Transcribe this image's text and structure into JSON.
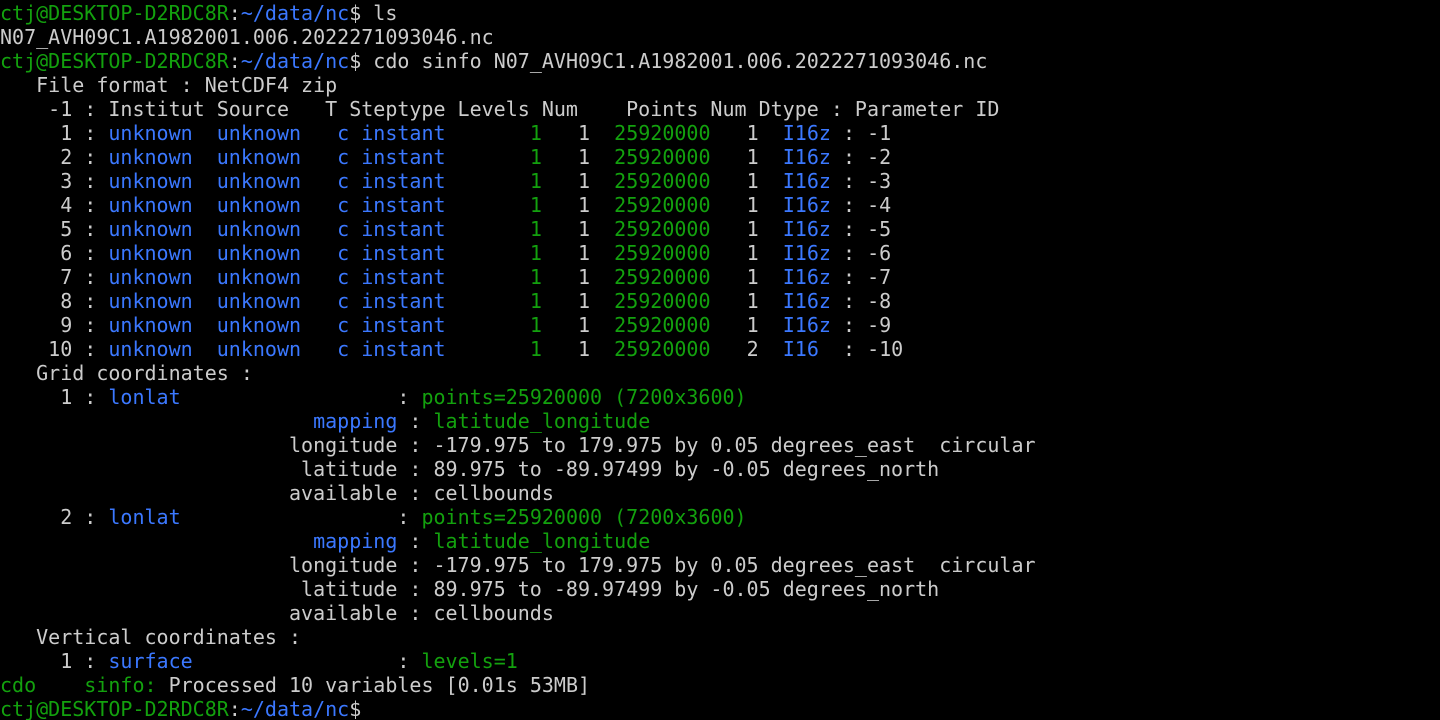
{
  "colors": {
    "background": "#000000",
    "text": "#cccccc",
    "green": "#13a10e",
    "blue": "#3b78ff"
  },
  "prompts": [
    {
      "user": "ctj@DESKTOP-D2RDC8R",
      "sep": ":",
      "path": "~/data/nc",
      "symbol": "$",
      "command": " ls"
    },
    {
      "user": "ctj@DESKTOP-D2RDC8R",
      "sep": ":",
      "path": "~/data/nc",
      "symbol": "$",
      "command": " cdo sinfo N07_AVH09C1.A1982001.006.2022271093046.nc"
    },
    {
      "user": "ctj@DESKTOP-D2RDC8R",
      "sep": ":",
      "path": "~/data/nc",
      "symbol": "$",
      "command": ""
    }
  ],
  "ls_output": "N07_AVH09C1.A1982001.006.2022271093046.nc",
  "file_format_line": "   File format : NetCDF4 zip",
  "table_header": "    -1 : Institut Source   T Steptype Levels Num    Points Num Dtype : Parameter ID",
  "variables": [
    {
      "num": "     1 : ",
      "institut": "unknown  ",
      "source": "unknown   ",
      "t": "c ",
      "steptype": "instant  ",
      "pad1": "     ",
      "levels": "1",
      "pad2": "   ",
      "num2": "1",
      "pad3": "  ",
      "points": "25920000",
      "pad4": "   ",
      "num3": "1",
      "pad5": "  ",
      "dtype": "I16z",
      "sep": " : ",
      "param": "-1"
    },
    {
      "num": "     2 : ",
      "institut": "unknown  ",
      "source": "unknown   ",
      "t": "c ",
      "steptype": "instant  ",
      "pad1": "     ",
      "levels": "1",
      "pad2": "   ",
      "num2": "1",
      "pad3": "  ",
      "points": "25920000",
      "pad4": "   ",
      "num3": "1",
      "pad5": "  ",
      "dtype": "I16z",
      "sep": " : ",
      "param": "-2"
    },
    {
      "num": "     3 : ",
      "institut": "unknown  ",
      "source": "unknown   ",
      "t": "c ",
      "steptype": "instant  ",
      "pad1": "     ",
      "levels": "1",
      "pad2": "   ",
      "num2": "1",
      "pad3": "  ",
      "points": "25920000",
      "pad4": "   ",
      "num3": "1",
      "pad5": "  ",
      "dtype": "I16z",
      "sep": " : ",
      "param": "-3"
    },
    {
      "num": "     4 : ",
      "institut": "unknown  ",
      "source": "unknown   ",
      "t": "c ",
      "steptype": "instant  ",
      "pad1": "     ",
      "levels": "1",
      "pad2": "   ",
      "num2": "1",
      "pad3": "  ",
      "points": "25920000",
      "pad4": "   ",
      "num3": "1",
      "pad5": "  ",
      "dtype": "I16z",
      "sep": " : ",
      "param": "-4"
    },
    {
      "num": "     5 : ",
      "institut": "unknown  ",
      "source": "unknown   ",
      "t": "c ",
      "steptype": "instant  ",
      "pad1": "     ",
      "levels": "1",
      "pad2": "   ",
      "num2": "1",
      "pad3": "  ",
      "points": "25920000",
      "pad4": "   ",
      "num3": "1",
      "pad5": "  ",
      "dtype": "I16z",
      "sep": " : ",
      "param": "-5"
    },
    {
      "num": "     6 : ",
      "institut": "unknown  ",
      "source": "unknown   ",
      "t": "c ",
      "steptype": "instant  ",
      "pad1": "     ",
      "levels": "1",
      "pad2": "   ",
      "num2": "1",
      "pad3": "  ",
      "points": "25920000",
      "pad4": "   ",
      "num3": "1",
      "pad5": "  ",
      "dtype": "I16z",
      "sep": " : ",
      "param": "-6"
    },
    {
      "num": "     7 : ",
      "institut": "unknown  ",
      "source": "unknown   ",
      "t": "c ",
      "steptype": "instant  ",
      "pad1": "     ",
      "levels": "1",
      "pad2": "   ",
      "num2": "1",
      "pad3": "  ",
      "points": "25920000",
      "pad4": "   ",
      "num3": "1",
      "pad5": "  ",
      "dtype": "I16z",
      "sep": " : ",
      "param": "-7"
    },
    {
      "num": "     8 : ",
      "institut": "unknown  ",
      "source": "unknown   ",
      "t": "c ",
      "steptype": "instant  ",
      "pad1": "     ",
      "levels": "1",
      "pad2": "   ",
      "num2": "1",
      "pad3": "  ",
      "points": "25920000",
      "pad4": "   ",
      "num3": "1",
      "pad5": "  ",
      "dtype": "I16z",
      "sep": " : ",
      "param": "-8"
    },
    {
      "num": "     9 : ",
      "institut": "unknown  ",
      "source": "unknown   ",
      "t": "c ",
      "steptype": "instant  ",
      "pad1": "     ",
      "levels": "1",
      "pad2": "   ",
      "num2": "1",
      "pad3": "  ",
      "points": "25920000",
      "pad4": "   ",
      "num3": "1",
      "pad5": "  ",
      "dtype": "I16z",
      "sep": " : ",
      "param": "-9"
    },
    {
      "num": "    10 : ",
      "institut": "unknown  ",
      "source": "unknown   ",
      "t": "c ",
      "steptype": "instant  ",
      "pad1": "     ",
      "levels": "1",
      "pad2": "   ",
      "num2": "1",
      "pad3": "  ",
      "points": "25920000",
      "pad4": "   ",
      "num3": "2",
      "pad5": "  ",
      "dtype": "I16 ",
      "sep": " : ",
      "param": "-10"
    }
  ],
  "grid_header": "   Grid coordinates :",
  "grids": [
    {
      "num": "     1 : ",
      "type": "lonlat",
      "type_pad": "                  : ",
      "points": "points=25920000 (7200x3600)",
      "mapping_indent": "                          ",
      "mapping_label": "mapping",
      "mapping_sep": " : ",
      "mapping_value": "latitude_longitude",
      "longitude": "                        longitude : -179.975 to 179.975 by 0.05 degrees_east  circular",
      "latitude": "                         latitude : 89.975 to -89.97499 by -0.05 degrees_north",
      "available": "                        available : cellbounds"
    },
    {
      "num": "     2 : ",
      "type": "lonlat",
      "type_pad": "                  : ",
      "points": "points=25920000 (7200x3600)",
      "mapping_indent": "                          ",
      "mapping_label": "mapping",
      "mapping_sep": " : ",
      "mapping_value": "latitude_longitude",
      "longitude": "                        longitude : -179.975 to 179.975 by 0.05 degrees_east  circular",
      "latitude": "                         latitude : 89.975 to -89.97499 by -0.05 degrees_north",
      "available": "                        available : cellbounds"
    }
  ],
  "vertical_header": "   Vertical coordinates :",
  "vertical": {
    "num": "     1 : ",
    "type": "surface",
    "type_pad": "                 : ",
    "levels": "levels=1"
  },
  "summary": {
    "prog": "cdo    sinfo:",
    "text": " Processed 10 variables [0.01s 53MB]"
  }
}
